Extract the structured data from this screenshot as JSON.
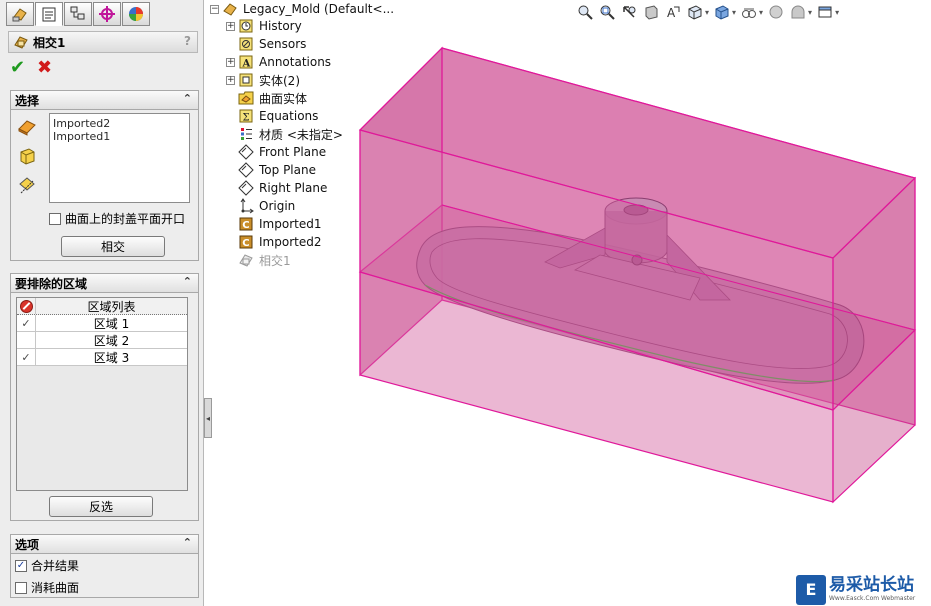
{
  "property_manager": {
    "feature_title": "相交1",
    "help": "?",
    "ok_symbol": "✔",
    "cancel_symbol": "✖",
    "selection_group": {
      "title": "选择",
      "items": [
        "Imported2",
        "Imported1"
      ],
      "cap_planar_label": "曲面上的封盖平面开口",
      "cap_planar_checked": false,
      "intersect_button": "相交"
    },
    "exclude_group": {
      "title": "要排除的区域",
      "column_header": "区域列表",
      "regions": [
        {
          "label": "区域  1",
          "checked": true
        },
        {
          "label": "区域  2",
          "checked": false
        },
        {
          "label": "区域  3",
          "checked": true
        }
      ],
      "invert_button": "反选"
    },
    "options_group": {
      "title": "选项",
      "merge_label": "合并结果",
      "merge_checked": true,
      "consume_label": "消耗曲面",
      "consume_checked": false
    },
    "collapse_symbol": "⌃"
  },
  "feature_tree": {
    "root": "Legacy_Mold  (Default<...",
    "items": [
      {
        "label": "History",
        "icon": "history-icon",
        "expandable": true
      },
      {
        "label": "Sensors",
        "icon": "sensors-icon",
        "expandable": false
      },
      {
        "label": "Annotations",
        "icon": "annotations-icon",
        "expandable": true
      },
      {
        "label": "实体(2)",
        "icon": "solid-bodies-icon",
        "expandable": true
      },
      {
        "label": "曲面实体",
        "icon": "surface-bodies-icon",
        "expandable": false
      },
      {
        "label": "Equations",
        "icon": "equations-icon",
        "expandable": false
      },
      {
        "label": "材质 <未指定>",
        "icon": "material-icon",
        "expandable": false
      },
      {
        "label": "Front Plane",
        "icon": "plane-icon",
        "expandable": false
      },
      {
        "label": "Top Plane",
        "icon": "plane-icon",
        "expandable": false
      },
      {
        "label": "Right Plane",
        "icon": "plane-icon",
        "expandable": false
      },
      {
        "label": "Origin",
        "icon": "origin-icon",
        "expandable": false
      },
      {
        "label": "Imported1",
        "icon": "imported-body-icon",
        "expandable": false
      },
      {
        "label": "Imported2",
        "icon": "imported-body-icon",
        "expandable": false
      },
      {
        "label": "相交1",
        "icon": "intersect-feature-icon",
        "expandable": false,
        "suppressed_look": true
      }
    ]
  },
  "toolbar": [
    "zoom-to-fit-icon",
    "zoom-area-icon",
    "previous-view-icon",
    "section-view-icon",
    "dynamic-annotation-icon",
    "view-orientation-icon",
    "display-style-icon",
    "hide-show-icon",
    "edit-appearance-icon",
    "apply-scene-icon",
    "view-settings-icon"
  ],
  "watermark": {
    "logo": "E",
    "title": "易采站长站",
    "subtitle": "Www.Easck.Com Webmaster"
  },
  "colors": {
    "box_fill": "#d35f9d",
    "box_edge": "#e0189a",
    "panel_bg": "#ededed"
  }
}
